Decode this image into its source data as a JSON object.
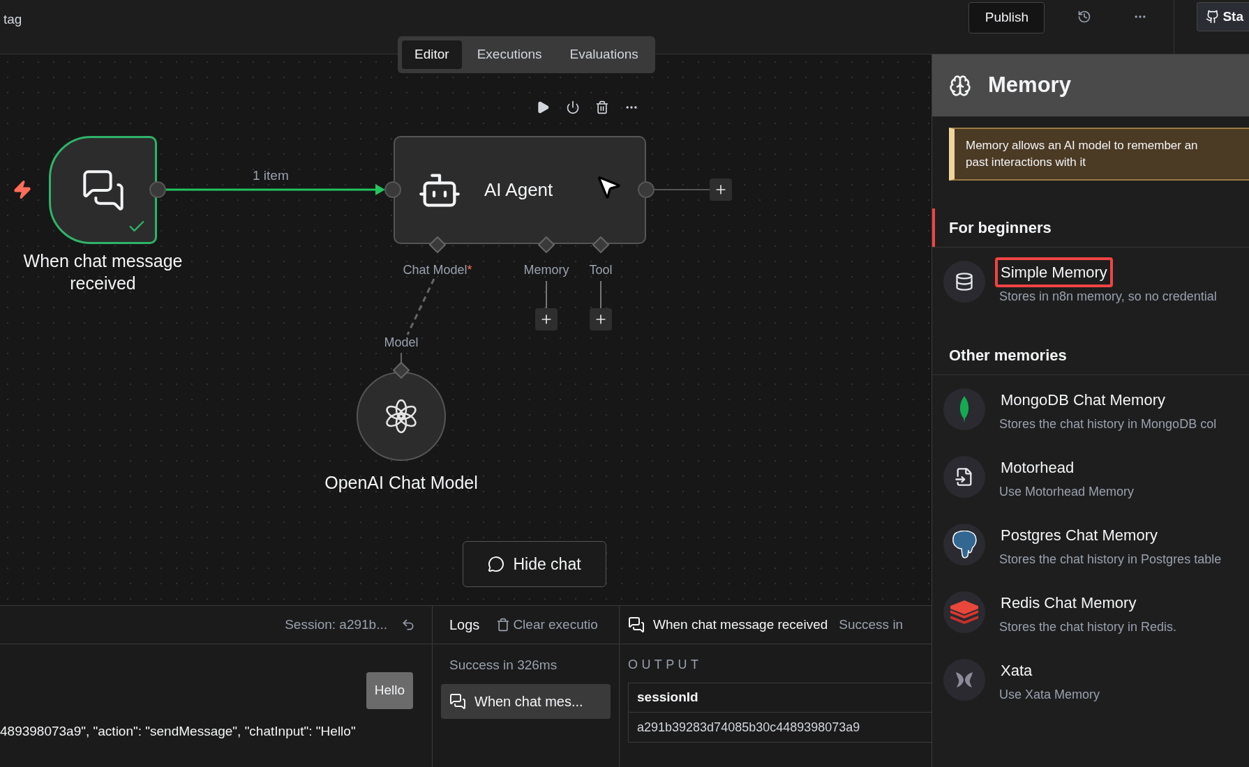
{
  "header": {
    "workflow_name": "tag",
    "publish": "Publish",
    "star": "Sta"
  },
  "tabs": [
    {
      "label": "Editor",
      "selected": true
    },
    {
      "label": "Executions",
      "selected": false
    },
    {
      "label": "Evaluations",
      "selected": false
    }
  ],
  "canvas": {
    "connection_label": "1 item",
    "trigger": {
      "label": "When chat message received",
      "success": true
    },
    "agent": {
      "label": "AI Agent",
      "inputs": [
        {
          "label": "Chat Model",
          "marker": "*"
        },
        {
          "label": "Memory"
        },
        {
          "label": "Tool"
        }
      ]
    },
    "model": {
      "label": "OpenAI Chat Model",
      "port": "Model"
    },
    "hide_chat": "Hide chat"
  },
  "chat": {
    "session": "Session: a291b...",
    "message": "Hello",
    "payload": "489398073a9\", \"action\": \"sendMessage\", \"chatInput\": \"Hello\""
  },
  "logs": {
    "title": "Logs",
    "clear": "Clear executio",
    "summary": "Success in 326ms",
    "entries": [
      {
        "label": "When chat mes...",
        "selected": true
      }
    ]
  },
  "output": {
    "node": "When chat message received",
    "status": "Success in",
    "section": "OUTPUT",
    "column": "sessionId",
    "value": "a291b39283d74085b30c4489398073a9"
  },
  "memory_panel": {
    "title": "Memory",
    "callout": [
      "Memory allows an AI model to remember an",
      "past interactions with it"
    ],
    "sections": [
      {
        "title": "For beginners",
        "active": true,
        "items": [
          {
            "kind": "database",
            "name": "Simple Memory",
            "description": "Stores in n8n memory, so no credential",
            "highlighted": true
          }
        ]
      },
      {
        "title": "Other memories",
        "active": false,
        "items": [
          {
            "kind": "leaf",
            "name": "MongoDB Chat Memory",
            "description": "Stores the chat history in MongoDB col",
            "highlighted": false
          },
          {
            "kind": "file",
            "name": "Motorhead",
            "description": "Use Motorhead Memory",
            "highlighted": false
          },
          {
            "kind": "elephant",
            "name": "Postgres Chat Memory",
            "description": "Stores the chat history in Postgres table",
            "highlighted": false
          },
          {
            "kind": "stack",
            "name": "Redis Chat Memory",
            "description": "Stores the chat history in Redis.",
            "highlighted": false
          },
          {
            "kind": "butterfly",
            "name": "Xata",
            "description": "Use Xata Memory",
            "highlighted": false
          }
        ]
      }
    ]
  }
}
